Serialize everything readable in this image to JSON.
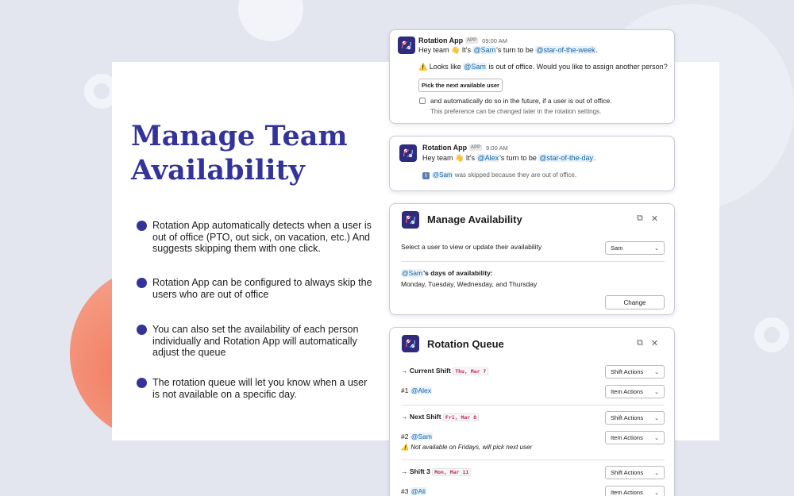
{
  "headline": {
    "line1": "Manage Team",
    "line2": "Availability"
  },
  "bullets": [
    "Rotation App automatically detects when a user is out of office (PTO, out sick, on vacation, etc.) And suggests skipping them with one click.",
    "Rotation App can be configured to always skip the users who are out of office",
    "You can also set the availability of each person individually and Rotation App will automatically adjust the queue",
    "The rotation queue will let you know when a user is not available on a specific day."
  ],
  "message1": {
    "app_name": "Rotation App",
    "tag": "APP",
    "time": "09:00 AM",
    "greeting_pre": "Hey team 👋 It's ",
    "mention_user": "@Sam",
    "greeting_mid": "'s turn to be ",
    "mention_role": "@star-of-the-week",
    "greeting_end": ".",
    "warn_pre": "⚠️ Looks like ",
    "warn_user": "@Sam",
    "warn_post": " is out of office. Would you like to assign another person?",
    "button_label": "Pick the next available user",
    "checkbox_label": "and automatically do so in the future, if a user is out of office.",
    "checkbox_note": "This preference can be changed later in the rotation settings."
  },
  "message2": {
    "app_name": "Rotation App",
    "tag": "APP",
    "time": "9:00 AM",
    "greeting_pre": "Hey team 👋 It's ",
    "mention_user": "@Alex",
    "greeting_mid": "'s turn to be ",
    "mention_role": "@star-of-the-day",
    "greeting_end": ".",
    "info_icon": "i",
    "skip_user": "@Sam",
    "skip_text": " was skipped because they are out of office."
  },
  "availability": {
    "title": "Manage Availability",
    "select_label": "Select a user to view or update their availability",
    "selected_user": "Sam",
    "user_mention": "@Sam",
    "days_label": "'s days of availability:",
    "days": "Monday, Tuesday, Wednesday, and Thursday",
    "change_button": "Change"
  },
  "queue": {
    "title": "Rotation Queue",
    "shift_actions": "Shift Actions",
    "item_actions": "Item Actions",
    "shifts": [
      {
        "label": "→ Current Shift",
        "date": "Thu, Mar 7",
        "rank": "#1",
        "user": "@Alex",
        "warning": ""
      },
      {
        "label": "→ Next Shift",
        "date": "Fri, Mar 8",
        "rank": "#2",
        "user": "@Sam",
        "warning": "Not available on Fridays, will pick next user"
      },
      {
        "label": "→ Shift 3",
        "date": "Mon, Mar 11",
        "rank": "#3",
        "user": "@Ali",
        "warning": ""
      }
    ]
  },
  "colors": {
    "brand": "#33339a",
    "mention": "#1264a3",
    "accent_orange": "#f27c62",
    "app_icon": "#2f2b7d"
  }
}
